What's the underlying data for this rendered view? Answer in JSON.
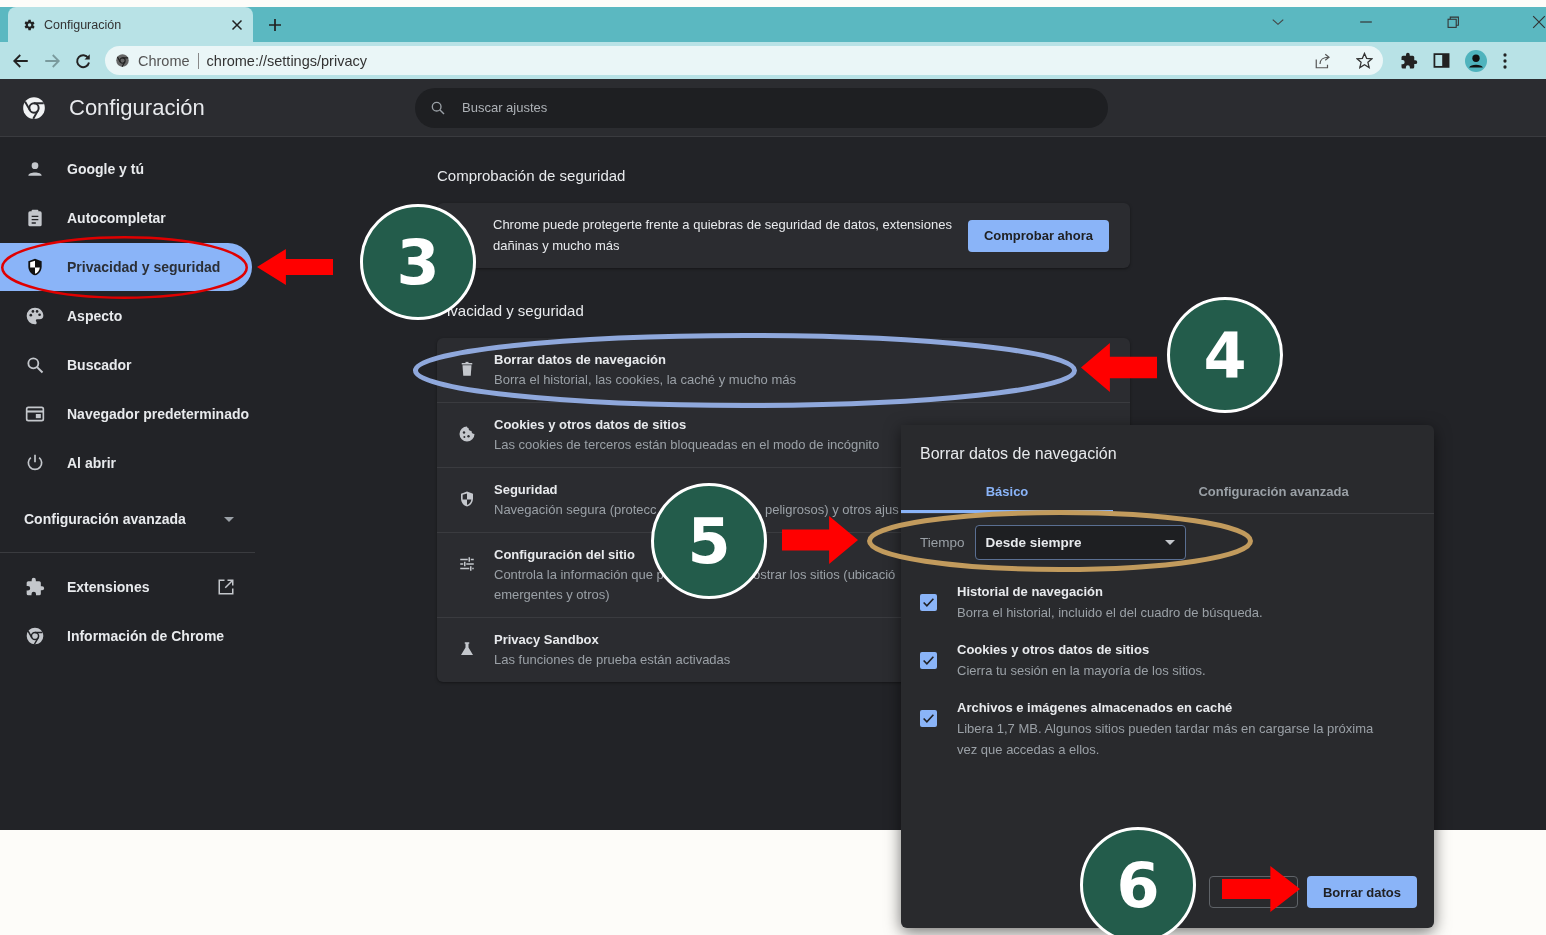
{
  "browser": {
    "tab": {
      "title": "Configuración",
      "selected": true
    },
    "address": {
      "site": "Chrome",
      "url": "chrome://settings/privacy"
    }
  },
  "header": {
    "title": "Configuración",
    "search": {
      "placeholder": "Buscar ajustes"
    }
  },
  "sidebar": {
    "items": [
      {
        "label": "Google y tú",
        "selected": false
      },
      {
        "label": "Autocompletar",
        "selected": false
      },
      {
        "label": "Privacidad y seguridad",
        "selected": true
      },
      {
        "label": "Aspecto",
        "selected": false
      },
      {
        "label": "Buscador",
        "selected": false
      },
      {
        "label": "Navegador predeterminado",
        "selected": false
      },
      {
        "label": "Al abrir",
        "selected": false
      }
    ],
    "advanced": {
      "label": "Configuración avanzada",
      "expanded": false
    },
    "links": [
      {
        "label": "Extensiones"
      },
      {
        "label": "Información de Chrome"
      }
    ]
  },
  "safety_check": {
    "heading": "Comprobación de seguridad",
    "description": "Chrome puede protegerte frente a quiebras de seguridad de datos, extensiones dañinas y mucho más",
    "button": "Comprobar ahora"
  },
  "privacy": {
    "heading": "ivacidad y seguridad",
    "rows": [
      {
        "title": "Borrar datos de navegación",
        "lines": [
          [
            "Borra el historial, las cookies, la caché y mucho más"
          ]
        ]
      },
      {
        "title": "Cookies y otros datos de sitios",
        "lines": [
          [
            "Las cookies de terceros están bloqueadas en el modo de incógnito"
          ]
        ]
      },
      {
        "title": "Seguridad",
        "lines": [
          [
            "Navegación segura (protecc",
            "peligrosos) y otros ajus"
          ]
        ]
      },
      {
        "title": "Configuración del sitio",
        "lines": [
          [
            "Controla la información que p",
            "ostrar los sitios (ubicació"
          ],
          [
            "emergentes y otros)"
          ]
        ]
      },
      {
        "title": "Privacy Sandbox",
        "lines": [
          [
            "Las funciones de prueba están activadas"
          ]
        ]
      }
    ]
  },
  "dialog": {
    "title": "Borrar datos de navegación",
    "tabs": [
      {
        "label": "Básico",
        "selected": true
      },
      {
        "label": "Configuración avanzada",
        "selected": false
      }
    ],
    "time": {
      "label": "Tiempo",
      "value": "Desde siempre"
    },
    "options": [
      {
        "title": "Historial de navegación",
        "description": "Borra el historial, incluido el del cuadro de búsqueda.",
        "checked": true
      },
      {
        "title": "Cookies y otros datos de sitios",
        "description": "Cierra tu sesión en la mayoría de los sitios.",
        "checked": true
      },
      {
        "title": "Archivos e imágenes almacenados en caché",
        "description": "Libera 1,7 MB. Algunos sitios pueden tardar más en cargarse la próxima vez que accedas a ellos.",
        "checked": true
      }
    ],
    "confirm_button": "Borrar datos"
  },
  "step_markers": [
    {
      "label": "3"
    },
    {
      "label": "4"
    },
    {
      "label": "5"
    },
    {
      "label": "6"
    }
  ]
}
